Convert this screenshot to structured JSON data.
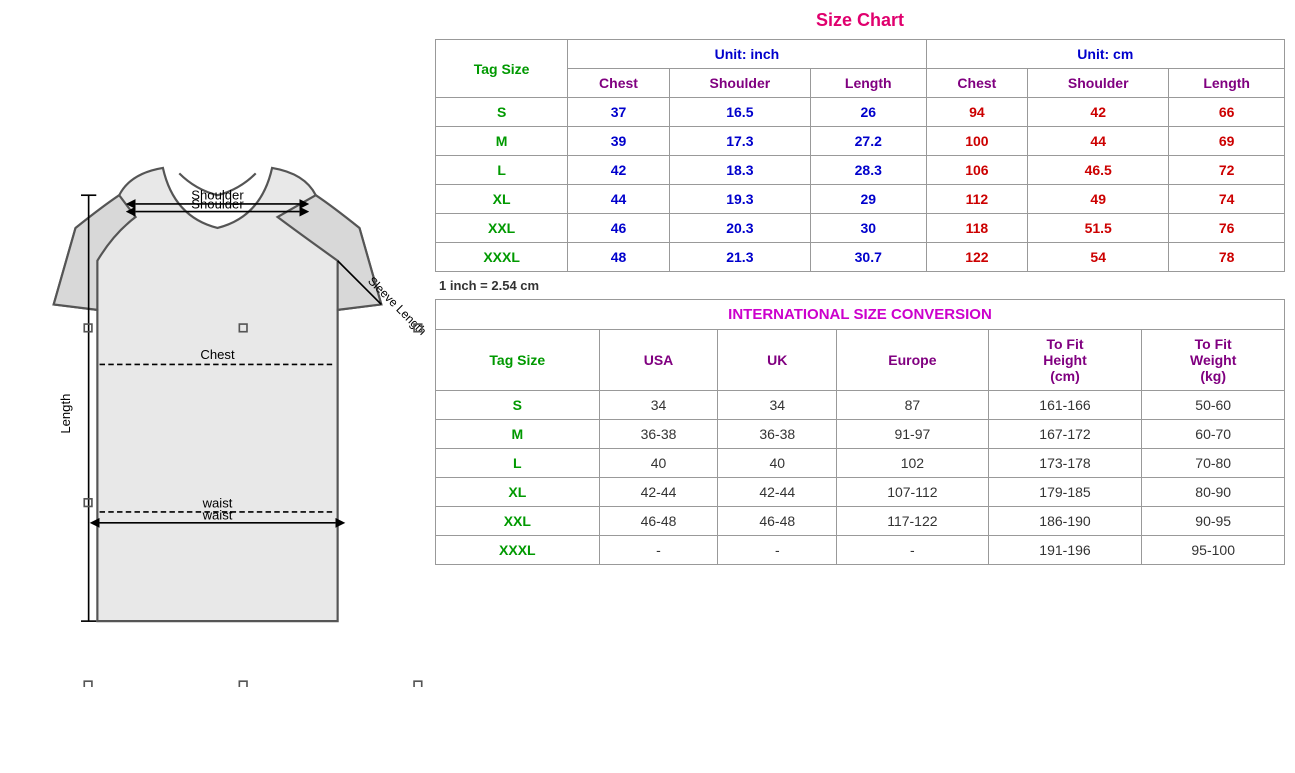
{
  "title": "Size Chart",
  "left": {
    "labels": {
      "shoulder": "Shoulder",
      "sleeve": "Sleeve Length",
      "chest": "Chest",
      "length": "Length",
      "waist": "waist"
    }
  },
  "sizeChart": {
    "title": "Size Chart",
    "unitInch": "Unit: inch",
    "unitCm": "Unit: cm",
    "tagSizeLabel": "Tag Size",
    "inchNote": "1 inch = 2.54 cm",
    "columns": {
      "chest": "Chest",
      "shoulder": "Shoulder",
      "length": "Length"
    },
    "rows": [
      {
        "tag": "S",
        "inchChest": "37",
        "inchShoulder": "16.5",
        "inchLength": "26",
        "cmChest": "94",
        "cmShoulder": "42",
        "cmLength": "66"
      },
      {
        "tag": "M",
        "inchChest": "39",
        "inchShoulder": "17.3",
        "inchLength": "27.2",
        "cmChest": "100",
        "cmShoulder": "44",
        "cmLength": "69"
      },
      {
        "tag": "L",
        "inchChest": "42",
        "inchShoulder": "18.3",
        "inchLength": "28.3",
        "cmChest": "106",
        "cmShoulder": "46.5",
        "cmLength": "72"
      },
      {
        "tag": "XL",
        "inchChest": "44",
        "inchShoulder": "19.3",
        "inchLength": "29",
        "cmChest": "112",
        "cmShoulder": "49",
        "cmLength": "74"
      },
      {
        "tag": "XXL",
        "inchChest": "46",
        "inchShoulder": "20.3",
        "inchLength": "30",
        "cmChest": "118",
        "cmShoulder": "51.5",
        "cmLength": "76"
      },
      {
        "tag": "XXXL",
        "inchChest": "48",
        "inchShoulder": "21.3",
        "inchLength": "30.7",
        "cmChest": "122",
        "cmShoulder": "54",
        "cmLength": "78"
      }
    ]
  },
  "intlConversion": {
    "title": "INTERNATIONAL SIZE CONVERSION",
    "tagSizeLabel": "Tag Size",
    "columns": {
      "usa": "USA",
      "uk": "UK",
      "europe": "Europe",
      "toFitHeight": "To Fit Height (cm)",
      "toFitWeight": "To Fit Weight (kg)"
    },
    "rows": [
      {
        "tag": "S",
        "usa": "34",
        "uk": "34",
        "europe": "87",
        "height": "161-166",
        "weight": "50-60"
      },
      {
        "tag": "M",
        "usa": "36-38",
        "uk": "36-38",
        "europe": "91-97",
        "height": "167-172",
        "weight": "60-70"
      },
      {
        "tag": "L",
        "usa": "40",
        "uk": "40",
        "europe": "102",
        "height": "173-178",
        "weight": "70-80"
      },
      {
        "tag": "XL",
        "usa": "42-44",
        "uk": "42-44",
        "europe": "107-112",
        "height": "179-185",
        "weight": "80-90"
      },
      {
        "tag": "XXL",
        "usa": "46-48",
        "uk": "46-48",
        "europe": "117-122",
        "height": "186-190",
        "weight": "90-95"
      },
      {
        "tag": "XXXL",
        "usa": "-",
        "uk": "-",
        "europe": "-",
        "height": "191-196",
        "weight": "95-100"
      }
    ]
  }
}
